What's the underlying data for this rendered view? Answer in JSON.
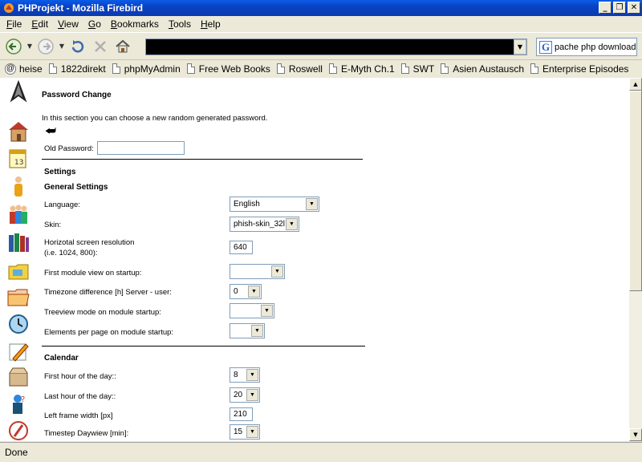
{
  "window": {
    "title": "PHProjekt - Mozilla Firebird",
    "minimize": "_",
    "maximize": "❐",
    "close": "✕"
  },
  "menu": {
    "items": [
      {
        "underline": "F",
        "rest": "ile"
      },
      {
        "underline": "E",
        "rest": "dit"
      },
      {
        "underline": "V",
        "rest": "iew"
      },
      {
        "underline": "G",
        "rest": "o"
      },
      {
        "underline": "B",
        "rest": "ookmarks"
      },
      {
        "underline": "T",
        "rest": "ools"
      },
      {
        "underline": "H",
        "rest": "elp"
      }
    ]
  },
  "navbar": {
    "search_text": "pache php download",
    "search_engine_icon": "G"
  },
  "bookmarks": {
    "items": [
      {
        "label": "heise",
        "icon": "at-icon"
      },
      {
        "label": "1822direkt",
        "icon": "page-icon"
      },
      {
        "label": "phpMyAdmin",
        "icon": "page-icon"
      },
      {
        "label": "Free Web Books",
        "icon": "page-icon"
      },
      {
        "label": "Roswell",
        "icon": "page-icon"
      },
      {
        "label": "E-Myth Ch.1",
        "icon": "page-icon"
      },
      {
        "label": "SWT",
        "icon": "page-icon"
      },
      {
        "label": "Asien Austausch",
        "icon": "page-icon"
      },
      {
        "label": "Enterprise Episodes",
        "icon": "page-icon"
      }
    ]
  },
  "page": {
    "title": "Password Change",
    "intro": "In this section you can choose a new random generated password.",
    "back_icon": "⮨",
    "old_password_label": "Old Password:",
    "old_password_value": "",
    "settings_heading": "Settings",
    "general_heading": "General Settings",
    "language_label": "Language:",
    "language_value": "English",
    "skin_label": "Skin:",
    "skin_value": "phish-skin_32l",
    "resolution_label_1": "Horizotal screen resolution",
    "resolution_label_2": "(i.e. 1024, 800):",
    "resolution_value": "640",
    "first_module_label": "First module view on startup:",
    "first_module_value": "",
    "timezone_label": "Timezone difference [h] Server - user:",
    "timezone_value": "0",
    "treeview_label": "Treeview mode on module startup:",
    "treeview_value": "",
    "elements_label": "Elements per page on module startup:",
    "elements_value": "",
    "calendar_heading": "Calendar",
    "first_hour_label": "First hour of the day::",
    "first_hour_value": "8",
    "last_hour_label": "Last hour of the day::",
    "last_hour_value": "20",
    "left_frame_label": "Left frame width [px]",
    "left_frame_value": "210",
    "timestep_label": "Timestep Daywiew [min]:",
    "timestep_value": "15"
  },
  "status": {
    "text": "Done"
  },
  "colors": {
    "titlebar": "#0842c4",
    "chrome": "#ece9d8",
    "content_bg": "#ffffff"
  }
}
